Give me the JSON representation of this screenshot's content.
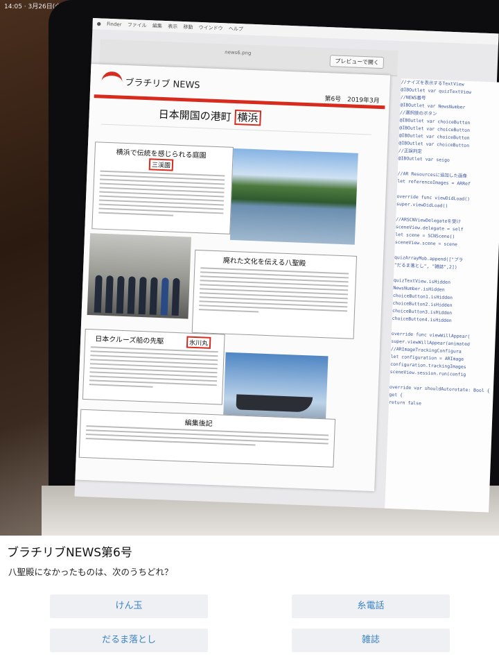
{
  "camera": {
    "status_text": "14:05 · 3月26日(火)"
  },
  "screen": {
    "menu_items": [
      "Finder",
      "ファイル",
      "編集",
      "表示",
      "移動",
      "ウインドウ",
      "ヘルプ"
    ],
    "window_title": "news6.png",
    "preview_button": "プレビューで開く"
  },
  "newsletter": {
    "brand": "ブラチリブ NEWS",
    "issue": "第6号　2019年3月",
    "headline_prefix": "日本開国の港町",
    "headline_boxed": "横浜",
    "articles": [
      {
        "title": "横浜で伝統を感じられる庭園",
        "boxed": "三渓園"
      },
      {
        "title": "廃れた文化を伝える八聖殿",
        "boxed": ""
      },
      {
        "title": "日本クルーズ船の先駆",
        "boxed": "氷川丸"
      },
      {
        "title": "編集後記",
        "boxed": ""
      }
    ]
  },
  "code_lines": [
    "//ナイズを表示するTextView",
    "@IBOutlet var quizTextView",
    "//NEWS番号",
    "@IBOutlet var NewsNumber",
    "//選択肢のボタン",
    "@IBOutlet var choiceButton",
    "@IBOutlet var choiceButton",
    "@IBOutlet var choiceButton",
    "@IBOutlet var choiceButton",
    "//正誤判定",
    "@IBOutlet var seigo",
    "",
    "//AR Resourcesに追加した画像",
    "let referenceImages = ARRef",
    "",
    "override func viewDidLoad()",
    "  super.viewDidLoad()",
    "",
    "  //ARSCNViewDelegateを受け",
    "  sceneView.delegate = self",
    "  let scene = SCNScene()",
    "  sceneView.scene = scene",
    "",
    "  quizArrayMob.append([\"ブラ",
    "  \"だるま落とし\", \"雑誌\",2])",
    "",
    "  quizTextView.isHidden",
    "  NewsNumber.isHidden",
    "  choiceButton1.isHidden",
    "  choiceButton2.isHidden",
    "  choiceButton3.isHidden",
    "  choiceButton4.isHidden",
    "",
    "override func viewWillAppear(",
    "  super.viewWillAppear(animated",
    "  //ARImageTrackingConfigura",
    "  let configuration = ARImage",
    "  configuration.trackingImages",
    "  sceneView.session.run(config",
    "",
    "override var shouldAutorotate: Bool {",
    "  get {",
    "    return false"
  ],
  "quiz": {
    "title": "ブラチリブNEWS第6号",
    "question": "八聖殿になかったものは、次のうちどれ？",
    "answers": [
      "けん玉",
      "糸電話",
      "だるま落とし",
      "雑誌"
    ]
  },
  "colors": {
    "accent_red": "#d62b1e",
    "answer_text": "#3b82c4",
    "answer_bg": "#eef0f4"
  }
}
